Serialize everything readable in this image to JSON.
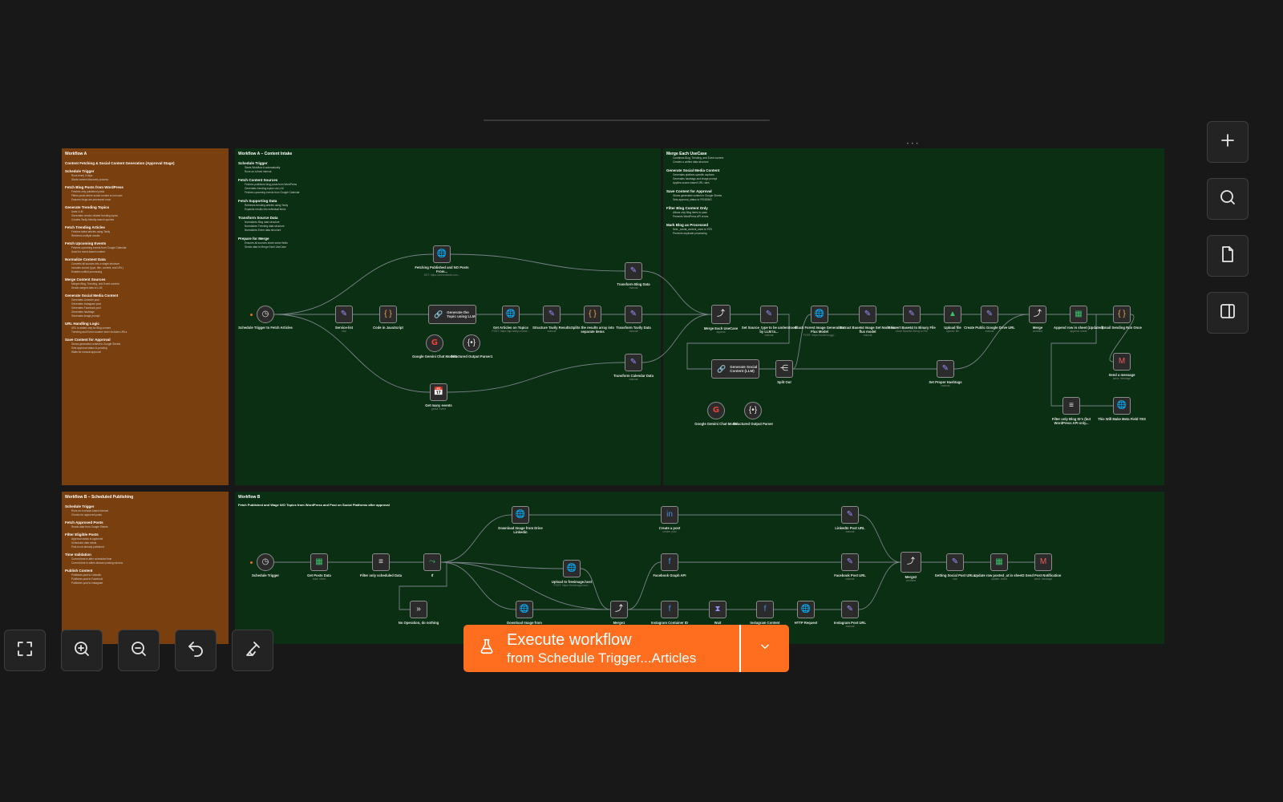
{
  "sticky_notes": [
    {
      "id": "a_overview",
      "title": "Workflow A",
      "blocks": [
        {
          "h": "Content Fetching & Social Content Generation (Approval Stage)",
          "b": []
        },
        {
          "h": "Schedule Trigger",
          "b": [
            "Runs every 3 days",
            "Starts content discovery process"
          ]
        },
        {
          "h": "Fetch Blog Posts from WordPress",
          "b": [
            "Fetches only published posts",
            "Filters posts where social content is not used",
            "Ensures blogs are processed once"
          ]
        },
        {
          "h": "Generate Trending Topics",
          "b": [
            "Uses LLM",
            "Generates vendor-related trending topics",
            "Creates Tavily-friendly search queries"
          ]
        },
        {
          "h": "Fetch Trending Articles",
          "b": [
            "Fetches latest articles using Tavily",
            "Retrieves multiple results"
          ]
        },
        {
          "h": "Fetch Upcoming Events",
          "b": [
            "Fetches upcoming events from Google Calendar",
            "Used for event-based content"
          ]
        },
        {
          "h": "Normalize Content Data",
          "b": [
            "Converts all sources into a single structure",
            "Includes source (type, title, content, and URL)",
            "Enables unified processing"
          ]
        },
        {
          "h": "Merge Content Sources",
          "b": [
            "Merges Blog, Trending, and Event content",
            "Sends merged data to LLM"
          ]
        },
        {
          "h": "Generate Social Media Content",
          "b": [
            "Generates LinkedIn post",
            "Generates Instagram post",
            "Generates Facebook post",
            "Generates hashtags",
            "Generates image prompt"
          ]
        },
        {
          "h": "URL Handling Logic",
          "b": [
            "URL is added only for Blog content",
            "Trending and Event content never includes URLs"
          ]
        },
        {
          "h": "Save Content for Approval",
          "b": [
            "Stores generated content in Google Sheets",
            "Sets approval status to pending",
            "Waits for manual approval"
          ]
        }
      ]
    },
    {
      "id": "a_intake",
      "title": "Workflow A – Content Intake",
      "blocks": [
        {
          "h": "Schedule Trigger",
          "b": [
            "Starts Workflow A automatically",
            "Runs on a fixed interval"
          ]
        },
        {
          "h": "Fetch Content Sources",
          "b": [
            "Fetches published blog posts from WordPress",
            "Generates trending topics via LLM",
            "Fetches upcoming events from Google Calendar"
          ]
        },
        {
          "h": "Fetch Supporting Data",
          "b": [
            "Retrieves trending articles using Tavily",
            "Expands results into individual items"
          ]
        },
        {
          "h": "Transform Source Data",
          "b": [
            "Normalizes Blog data structure",
            "Normalizes Trending data structure",
            "Normalizes Event data structure"
          ]
        },
        {
          "h": "Prepare for Merge",
          "b": [
            "Ensures all sources share same fields",
            "Sends data to Merge Each UseCase"
          ]
        }
      ]
    },
    {
      "id": "a_merge",
      "title": "Merge Each UseCase",
      "blocks": [
        {
          "h": "",
          "b": [
            "Combines Blog, Trending, and Event content",
            "Creates a unified data structure"
          ]
        },
        {
          "h": "Generate Social Media Content",
          "b": [
            "Generates platform-specific captions",
            "Generates hashtags and image prompt",
            "Applies source-based URL rules"
          ]
        },
        {
          "h": "Save Content for Approval",
          "b": [
            "Stores generated content in Google Sheets",
            "Sets approval_status to PENDING"
          ]
        },
        {
          "h": "Filter Blog Content Only",
          "b": [
            "Allows only Blog items to pass",
            "Prevents WordPress API errors"
          ]
        },
        {
          "h": "Mark Blog as Processed",
          "b": [
            "Sets _social_content_used to YES",
            "Prevents duplicate processing"
          ]
        }
      ]
    },
    {
      "id": "b_overview",
      "title": "Workflow B – Scheduled Publishing",
      "blocks": [
        {
          "h": "Schedule Trigger",
          "b": [
            "Runs on a minute-based interval",
            "Checks for approved posts"
          ]
        },
        {
          "h": "Fetch Approved Posts",
          "b": [
            "Reads data from Google Sheets"
          ]
        },
        {
          "h": "Filter Eligible Posts",
          "b": [
            "Approval status is approved",
            "Scheduled date exists",
            "Post is not already published"
          ]
        },
        {
          "h": "Time Validation",
          "b": [
            "Current time is after scheduled time",
            "Current time is within allowed posting window"
          ]
        },
        {
          "h": "Publish Content",
          "b": [
            "Publishes post to LinkedIn",
            "Publishes post to Facebook",
            "Publishes post to Instagram"
          ]
        }
      ]
    },
    {
      "id": "b_main",
      "title": "Workflow B",
      "subtitle": "Fetch Published and Wage N/O Topics from WordPress and Post on Social Platforms after approval",
      "blocks": []
    }
  ],
  "nodes": {
    "schedule_trigger_a": {
      "label": "Schedule Trigger to Fetch Articles",
      "sub": "",
      "icon": "◷"
    },
    "fetch_published": {
      "label": "Fetching Published and NO Posts From...",
      "sub": "GET: https://creventiwet.com...",
      "icon": "🌐"
    },
    "service_list": {
      "label": "Service-list",
      "sub": "raw",
      "icon": "✎"
    },
    "code_js": {
      "label": "Code in JavaScript",
      "sub": "",
      "icon": "{ }"
    },
    "gen_topic_llm": {
      "label": "Generate the Topic using LLM",
      "sub": "",
      "icon": "🔗"
    },
    "gemini_model_1": {
      "label": "Google Gemini Chat Model1",
      "sub": "",
      "icon": "G"
    },
    "structured_parser_1": {
      "label": "Structured Output Parser1",
      "sub": "",
      "icon": "{•}"
    },
    "get_articles": {
      "label": "Get Articles on Topics",
      "sub": "POST: https://api.tavily.com/se...",
      "icon": "🌐"
    },
    "structure_tavily": {
      "label": "Structure Tavily Results",
      "sub": "manual",
      "icon": "✎"
    },
    "splits_array": {
      "label": "Splits the results array into separate items",
      "sub": "",
      "icon": "{ }"
    },
    "transform_tavily": {
      "label": "Transform Tavily Data",
      "sub": "manual",
      "icon": "✎"
    },
    "transform_blog": {
      "label": "Transform Blog Data",
      "sub": "manual",
      "icon": "✎"
    },
    "transform_calendar": {
      "label": "Transform Calendar Data",
      "sub": "manual",
      "icon": "✎"
    },
    "get_events": {
      "label": "Get many events",
      "sub": "getAll: event",
      "icon": "📅"
    },
    "merge_usecase": {
      "label": "Merge Each UseCase",
      "sub": "append",
      "icon": "⤴"
    },
    "set_source_type": {
      "label": "Set Source_type to be understood by LLM to...",
      "sub": "manual",
      "icon": "✎"
    },
    "black_forest": {
      "label": "Black Forest Image Generation Flux Model",
      "sub": "POST: https://router.huggi...",
      "icon": "🌐"
    },
    "extract_base64": {
      "label": "Extract Base64 Image Set Node for flux model",
      "sub": "manual",
      "icon": "✎"
    },
    "convert_base64": {
      "label": "Convert Base64 to Binary File",
      "sub": "Move Base64 String to File",
      "icon": "✎"
    },
    "upload_file": {
      "label": "Upload file",
      "sub": "upload: file",
      "icon": "▲"
    },
    "create_drive_url": {
      "label": "Create Public Google Drive URL",
      "sub": "manual",
      "icon": "✎"
    },
    "merge_a": {
      "label": "Merge",
      "sub": "combine",
      "icon": "⤴"
    },
    "append_sheet": {
      "label": "Append row in sheet (Updated)",
      "sub": "append: sheet",
      "icon": "▦"
    },
    "email_sending": {
      "label": "Email Sending Run Once",
      "sub": "",
      "icon": "{ }"
    },
    "send_message_a": {
      "label": "Send a message",
      "sub": "send: message",
      "icon": "M"
    },
    "gen_social_llm": {
      "label": "Generate Social Content (LLM)",
      "sub": "",
      "icon": "🔗"
    },
    "gemini_model_2": {
      "label": "Google Gemini Chat Model",
      "sub": "",
      "icon": "G"
    },
    "structured_parser_2": {
      "label": "Structured Output Parser",
      "sub": "",
      "icon": "{•}"
    },
    "split_out": {
      "label": "Split Out",
      "sub": "",
      "icon": "⋲"
    },
    "set_hashtags": {
      "label": "Set Proper Hashtags",
      "sub": "manual",
      "icon": "✎"
    },
    "filter_blog": {
      "label": "Filter only Blog ID's (but WordPress API only...",
      "sub": "",
      "icon": "≡"
    },
    "make_meta": {
      "label": "This Will Make Meta Field YES",
      "sub": "",
      "icon": "🌐"
    },
    "schedule_trigger_b": {
      "label": "Schedule Trigger",
      "sub": "",
      "icon": "◷"
    },
    "get_posts_data": {
      "label": "Get Posts Data",
      "sub": "read: sheet",
      "icon": "▦"
    },
    "filter_scheduled": {
      "label": "Filter only scheduled Data",
      "sub": "",
      "icon": "≡"
    },
    "if_node": {
      "label": "If",
      "sub": "",
      "icon": "⤳"
    },
    "no_operation": {
      "label": "No Operation, do nothing",
      "sub": "",
      "icon": "»"
    },
    "download_drive_linkedin": {
      "label": "Download Image from Drive Linkedin",
      "sub": "",
      "icon": "🌐"
    },
    "create_post": {
      "label": "Create a post",
      "sub": "create: post",
      "icon": "in"
    },
    "linkedin_url": {
      "label": "LinkedIn Post URL",
      "sub": "manual",
      "icon": "✎"
    },
    "upload_freeimage": {
      "label": "Upload to freeimage.host",
      "sub": "POST: https://freeimage.host...",
      "icon": "🌐"
    },
    "download_image_b": {
      "label": "Download Image from",
      "sub": "",
      "icon": "🌐"
    },
    "merge_b1": {
      "label": "Merge1",
      "sub": "",
      "icon": "⤴"
    },
    "facebook_graph": {
      "label": "Facebook Graph API",
      "sub": "",
      "icon": "f"
    },
    "facebook_url": {
      "label": "Facebook Post URL",
      "sub": "manual",
      "icon": "✎"
    },
    "instagram_container": {
      "label": "Instagram Container ID",
      "sub": "",
      "icon": "f"
    },
    "wait": {
      "label": "Wait",
      "sub": "",
      "icon": "⧗"
    },
    "instagram_content": {
      "label": "Instagram Content",
      "sub": "",
      "icon": "f"
    },
    "http_request": {
      "label": "HTTP Request",
      "sub": "",
      "icon": "🌐"
    },
    "instagram_url": {
      "label": "Instagram Post URL",
      "sub": "manual",
      "icon": "✎"
    },
    "merge2": {
      "label": "Merge2",
      "sub": "combine",
      "icon": "⤴"
    },
    "getting_social_urls": {
      "label": "Getting Social Post URLs",
      "sub": "raw",
      "icon": "✎"
    },
    "update_row": {
      "label": "Update row posted_at in sheet2",
      "sub": "update: sheet",
      "icon": "▦"
    },
    "send_post_notification": {
      "label": "Send Post Notification",
      "sub": "send: message",
      "icon": "M"
    }
  },
  "controls": {
    "right": [
      {
        "name": "add-node-button",
        "icon": "plus-icon"
      },
      {
        "name": "search-button",
        "icon": "search-icon"
      },
      {
        "name": "sticky-note-button",
        "icon": "note-icon"
      },
      {
        "name": "toggle-panel-button",
        "icon": "panel-icon"
      }
    ],
    "bottom": [
      {
        "name": "fit-view-button",
        "icon": "fit-icon"
      },
      {
        "name": "zoom-in-button",
        "icon": "zoom-in-icon"
      },
      {
        "name": "zoom-out-button",
        "icon": "zoom-out-icon"
      },
      {
        "name": "undo-button",
        "icon": "undo-icon"
      },
      {
        "name": "tidy-up-button",
        "icon": "broom-icon"
      }
    ]
  },
  "execute": {
    "title": "Execute workflow",
    "subtitle": "from Schedule Trigger...Articles",
    "icon": "flask-icon"
  },
  "colors": {
    "canvas": "#181818",
    "sticky_orange": "#7a3f0e",
    "sticky_green": "#0a2f13",
    "accent": "#ff6d1f"
  }
}
